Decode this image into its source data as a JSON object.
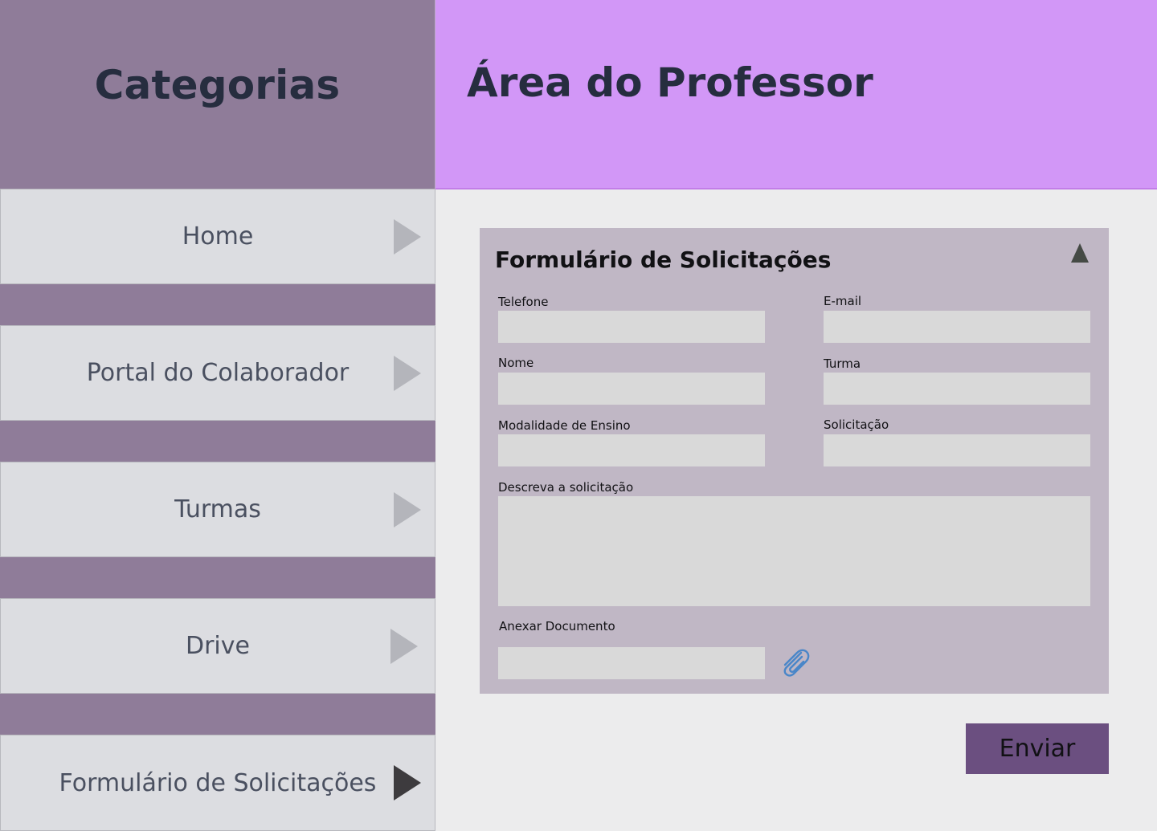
{
  "sidebar": {
    "title": "Categorias",
    "items": [
      {
        "label": "Home",
        "active": false
      },
      {
        "label": "Portal do Colaborador",
        "active": false
      },
      {
        "label": "Turmas",
        "active": false
      },
      {
        "label": "Drive",
        "active": false
      },
      {
        "label": "Formulário de Solicitações",
        "active": true
      }
    ]
  },
  "header": {
    "title": "Área do Professor"
  },
  "form": {
    "title": "Formulário de Solicitações",
    "collapse_icon": "triangle-up-icon",
    "fields": {
      "telefone": {
        "label": "Telefone",
        "value": ""
      },
      "email": {
        "label": "E-mail",
        "value": ""
      },
      "nome": {
        "label": "Nome",
        "value": ""
      },
      "turma": {
        "label": "Turma",
        "value": ""
      },
      "modalidade": {
        "label": "Modalidade de Ensino",
        "value": ""
      },
      "solicitacao": {
        "label": "Solicitação",
        "value": ""
      },
      "descricao": {
        "label": "Descreva a solicitação",
        "value": ""
      },
      "anexo": {
        "label": "Anexar Documento",
        "value": "",
        "icon": "paperclip-icon"
      }
    },
    "submit_label": "Enviar"
  },
  "colors": {
    "sidebar_bg": "#8f7c99",
    "header_bg": "#d297f7",
    "nav_item_bg": "#dcdde1",
    "form_bg": "#c0b7c5",
    "input_bg": "#d9d9d9",
    "submit_bg": "#6b4f80",
    "attach_icon": "#4a86c8"
  }
}
